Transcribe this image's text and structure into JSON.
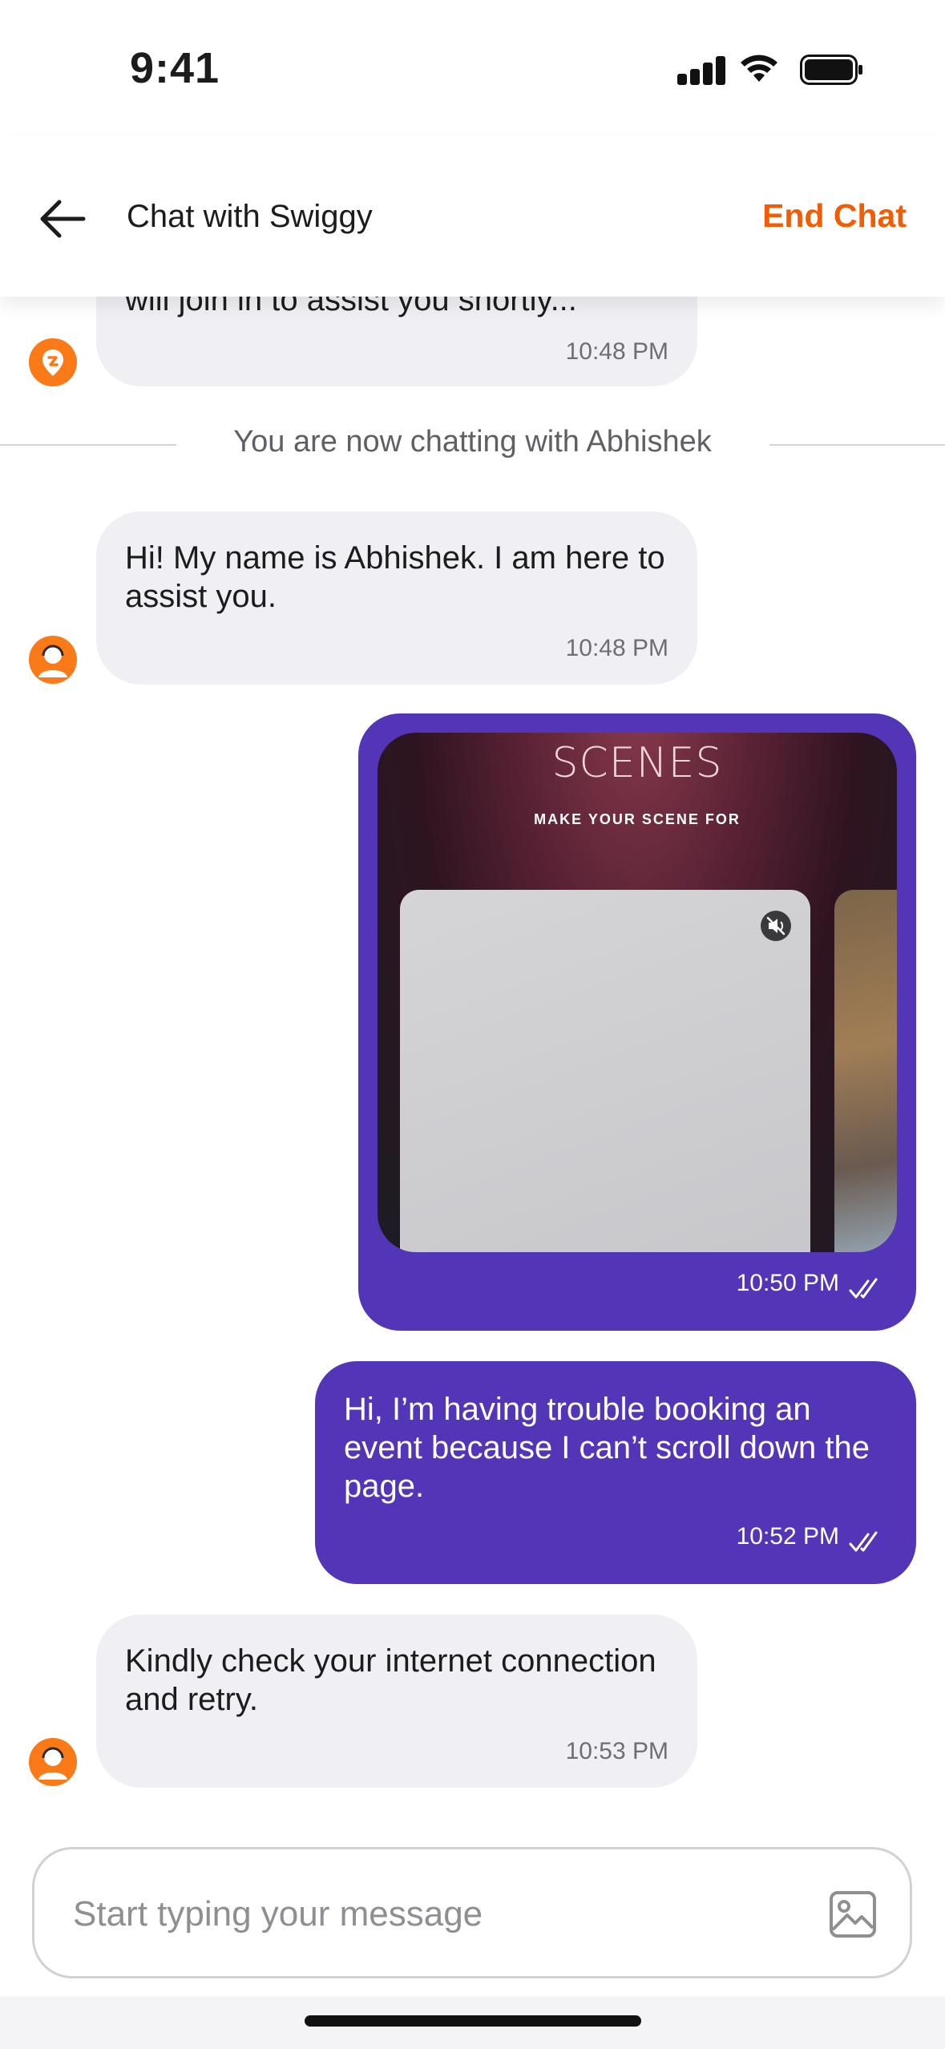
{
  "status_bar": {
    "time": "9:41"
  },
  "header": {
    "title": "Chat with Swiggy",
    "end_chat_label": "End Chat"
  },
  "messages": [
    {
      "sender": "bot",
      "text": "will join in to assist you shortly...",
      "time": "10:48 PM"
    },
    {
      "sender": "agent",
      "text": "Hi! My name is Abhishek. I am here to assist you.",
      "time": "10:48 PM"
    },
    {
      "sender": "user",
      "type": "media",
      "time": "10:50 PM",
      "media": {
        "logo": "SCENES",
        "subtitle": "MAKE YOUR SCENE FOR"
      }
    },
    {
      "sender": "user",
      "text": "Hi, I’m having trouble booking an event because I can’t scroll down the page.",
      "time": "10:52 PM"
    },
    {
      "sender": "agent",
      "text": "Kindly check your internet connection and retry.",
      "time": "10:53 PM"
    }
  ],
  "system_notice": "You are now chatting with Abhishek",
  "composer": {
    "placeholder": "Start typing your message",
    "value": ""
  },
  "colors": {
    "accent": "#f25c05",
    "user_bubble": "#5335b8",
    "bot_bubble": "#efeff4",
    "avatar": "#f97a16"
  },
  "icons": [
    "back-arrow-icon",
    "swiggy-logo-icon",
    "agent-avatar-icon",
    "mute-icon",
    "double-check-icon",
    "image-icon"
  ]
}
